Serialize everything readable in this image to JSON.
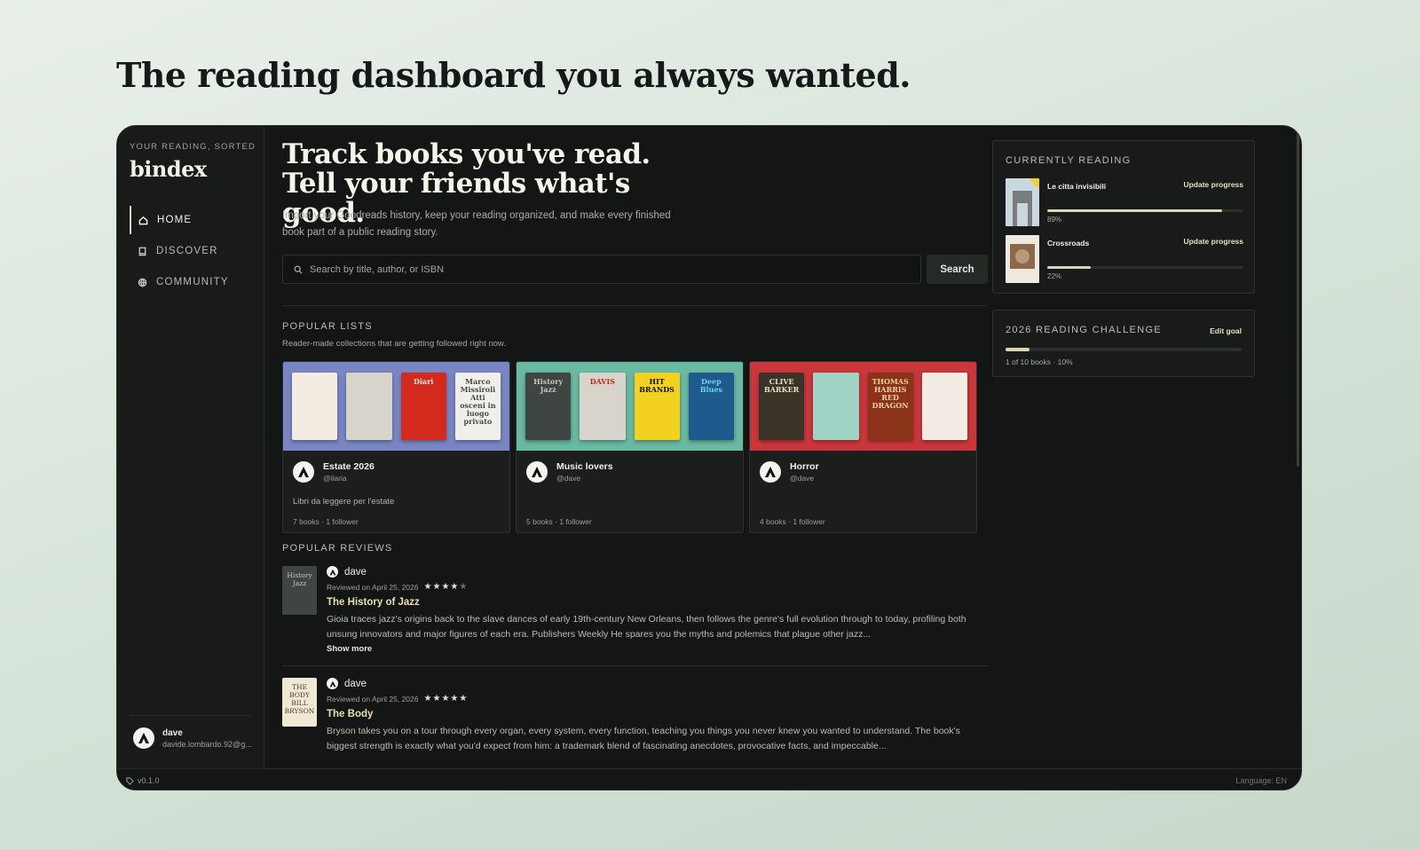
{
  "page": {
    "hero_title": "The reading dashboard you always wanted."
  },
  "sidebar": {
    "tagline": "YOUR READING, SORTED",
    "logo": "bindex",
    "nav": [
      {
        "label": "HOME",
        "icon": "home-icon",
        "active": true
      },
      {
        "label": "DISCOVER",
        "icon": "book-icon",
        "active": false
      },
      {
        "label": "COMMUNITY",
        "icon": "globe-icon",
        "active": false
      }
    ],
    "user": {
      "name": "dave",
      "email": "davide.lombardo.92@g..."
    }
  },
  "footer": {
    "version": "v0.1.0",
    "language": "Language: EN"
  },
  "main": {
    "title": "Track books you've read. Tell your friends what's good.",
    "description": "Import your Goodreads history, keep your reading organized, and make every finished book part of a public reading story.",
    "search": {
      "placeholder": "Search by title, author, or ISBN",
      "button": "Search"
    },
    "popular_lists": {
      "title": "POPULAR LISTS",
      "subtitle": "Reader-made collections that are getting followed right now.",
      "cards": [
        {
          "title": "Estate 2026",
          "handle": "@ilaria",
          "description": "Libri da leggere per l'estate",
          "meta": "7 books · 1 follower",
          "bg": "#7a86c4",
          "covers": [
            {
              "text": "",
              "bg": "#f2ede0",
              "fg": "#6b5a3a"
            },
            {
              "text": "",
              "bg": "#d8d4cc",
              "fg": "#2a2a2a"
            },
            {
              "text": "Diari",
              "bg": "#d42a1e",
              "fg": "#f6f1e8"
            },
            {
              "text": "Marco Missiroli\nAtti osceni in luogo privato",
              "bg": "#f1efea",
              "fg": "#4a4a4a"
            }
          ]
        },
        {
          "title": "Music lovers",
          "handle": "@dave",
          "description": "",
          "meta": "5 books · 1 follower",
          "bg": "#6ab9a2",
          "covers": [
            {
              "text": "History Jazz",
              "bg": "#3f4542",
              "fg": "#c9c5b8"
            },
            {
              "text": "DAVIS",
              "bg": "#d9d4cb",
              "fg": "#c0271e"
            },
            {
              "text": "HIT BRANDS",
              "bg": "#f2d21e",
              "fg": "#111111"
            },
            {
              "text": "Deep Blues",
              "bg": "#1e5a8c",
              "fg": "#6fd1ee"
            }
          ]
        },
        {
          "title": "Horror",
          "handle": "@dave",
          "description": "",
          "meta": "4 books · 1 follower",
          "bg": "#c9373c",
          "covers": [
            {
              "text": "CLIVE BARKER",
              "bg": "#3a3428",
              "fg": "#e8ddc2"
            },
            {
              "text": "",
              "bg": "#9fd4c4",
              "fg": "#2a5a4a"
            },
            {
              "text": "THOMAS HARRIS\nRED DRAGON",
              "bg": "#8a3318",
              "fg": "#f3cfa8"
            },
            {
              "text": "",
              "bg": "#f3ece4",
              "fg": "#c2242c"
            }
          ]
        }
      ]
    },
    "popular_reviews": {
      "title": "POPULAR REVIEWS",
      "items": [
        {
          "user": "dave",
          "date": "Reviewed on April 25, 2026",
          "rating": 4,
          "book": "The History of Jazz",
          "text": "Gioia traces jazz's origins back to the slave dances of early 19th-century New Orleans, then follows the genre's full evolution through to today, profiling both unsung innovators and major figures of each era. Publishers Weekly He spares you the myths and polemics that plague other jazz...",
          "show_more": "Show more",
          "cover_text": "History Jazz",
          "cover_bg": "#3f4542",
          "cover_fg": "#c9c5b8"
        },
        {
          "user": "dave",
          "date": "Reviewed on April 25, 2026",
          "rating": 5,
          "book": "The Body",
          "text": "Bryson takes you on a tour through every organ, every system, every function, teaching you things you never knew you wanted to understand. The book's biggest strength is exactly what you'd expect from him: a trademark blend of fascinating anecdotes, provocative facts, and impeccable...",
          "show_more": "",
          "cover_text": "THE BODY BILL BRYSON",
          "cover_bg": "#efe8d6",
          "cover_fg": "#5a3a22"
        }
      ]
    }
  },
  "currently_reading": {
    "title": "CURRENTLY READING",
    "items": [
      {
        "title": "Le citta invisibili",
        "link": "Update progress",
        "progress": 89,
        "progress_label": "89%",
        "cover_bg": "#c9d8de"
      },
      {
        "title": "Crossroads",
        "link": "Update progress",
        "progress": 22,
        "progress_label": "22%",
        "cover_bg": "#e6ddcf"
      }
    ]
  },
  "challenge": {
    "title": "2026 READING CHALLENGE",
    "edit_label": "Edit goal",
    "progress": 10,
    "meta": "1 of 10 books · 10%"
  },
  "colors": {
    "accent": "#dcd6b8",
    "panel": "#181b19",
    "app_bg": "#131614"
  }
}
